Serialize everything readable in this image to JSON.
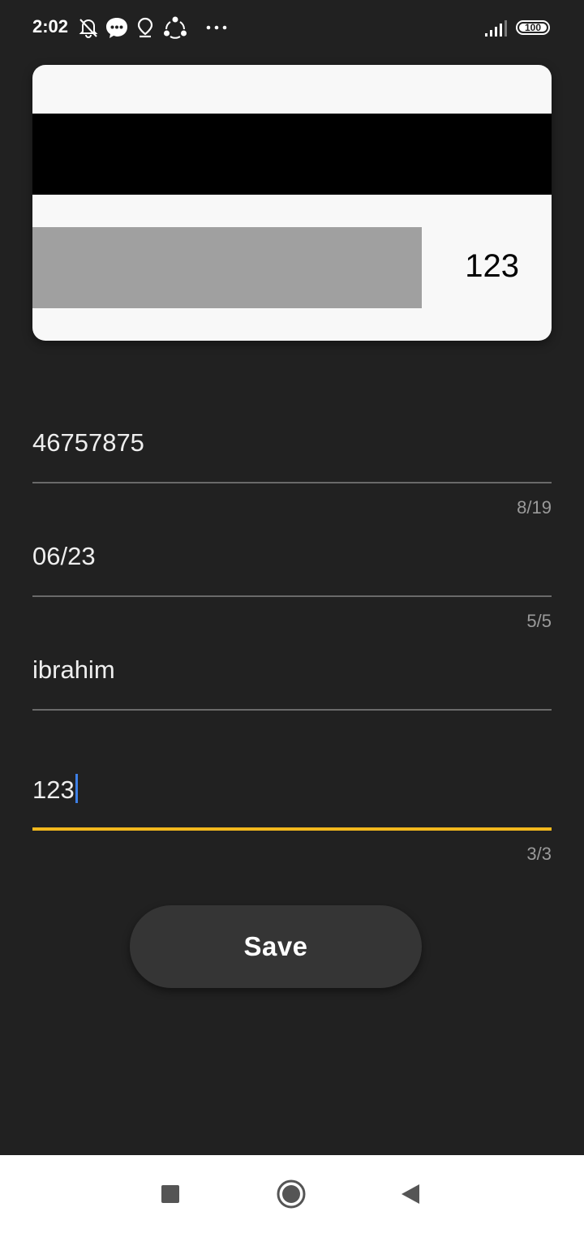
{
  "status_bar": {
    "time": "2:02",
    "battery": "100",
    "icons": [
      "mute-bell-icon",
      "chat-bubble-icon",
      "location-pin-icon",
      "share-icon",
      "more-dots-icon",
      "signal-icon",
      "battery-icon"
    ]
  },
  "card_preview": {
    "cvv": "123"
  },
  "form": {
    "card_number": {
      "value": "46757875",
      "counter": "8/19"
    },
    "expiry": {
      "value": "06/23",
      "counter": "5/5"
    },
    "holder_name": {
      "value": "ibrahim"
    },
    "cvv": {
      "value": "123",
      "counter": "3/3"
    }
  },
  "actions": {
    "save_label": "Save"
  },
  "nav_bar": {
    "icons": [
      "recents-square-icon",
      "home-circle-icon",
      "back-triangle-icon"
    ]
  },
  "colors": {
    "background": "#212121",
    "card": "#f8f8f8",
    "accent_underline": "#f2b81d",
    "caret": "#3d7fe6",
    "button": "#353535"
  }
}
